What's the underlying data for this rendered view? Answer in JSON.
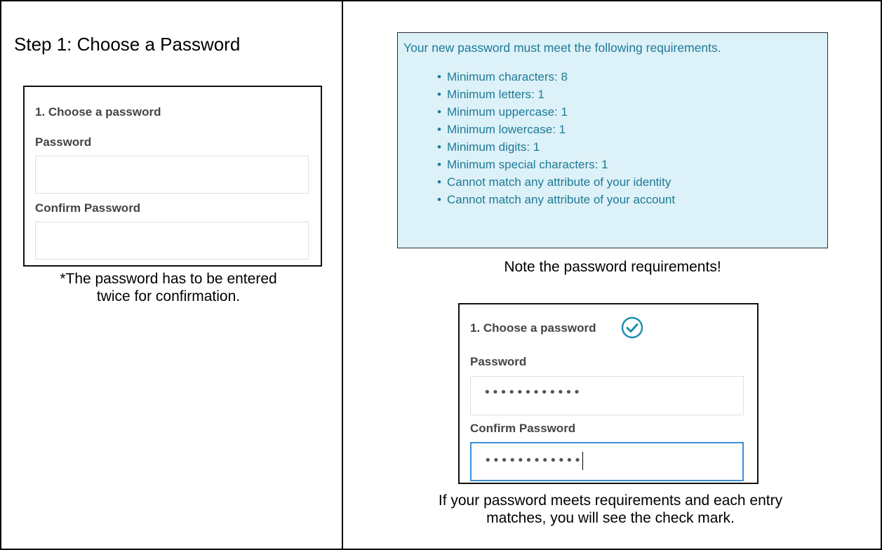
{
  "page_title": "Step 1: Choose a Password",
  "left_panel": {
    "form": {
      "heading": "1. Choose a password",
      "password_label": "Password",
      "password_value": "",
      "confirm_label": "Confirm Password",
      "confirm_value": ""
    },
    "caption_line1": "*The password has to be entered",
    "caption_line2": "twice for confirmation."
  },
  "requirements": {
    "intro": "Your new password must meet the following requirements.",
    "items": [
      "Minimum characters: 8",
      "Minimum letters: 1",
      "Minimum uppercase: 1",
      "Minimum lowercase: 1",
      "Minimum digits: 1",
      "Minimum special characters: 1",
      "Cannot match any attribute of your identity",
      "Cannot match any attribute of your account"
    ],
    "caption": "Note the password requirements!",
    "colors": {
      "background": "#ddf1f8",
      "text": "#1d7a96"
    }
  },
  "right_panel": {
    "form": {
      "heading": "1. Choose a password",
      "check_icon": "check-circle-icon",
      "password_label": "Password",
      "password_mask": "••••••••••••",
      "confirm_label": "Confirm Password",
      "confirm_mask": "••••••••••••"
    },
    "caption_line1": "If your password meets requirements and each entry",
    "caption_line2": "matches, you will see the check mark.",
    "colors": {
      "accent": "#1d8fb0",
      "focus_border": "#3c8fd6"
    }
  }
}
